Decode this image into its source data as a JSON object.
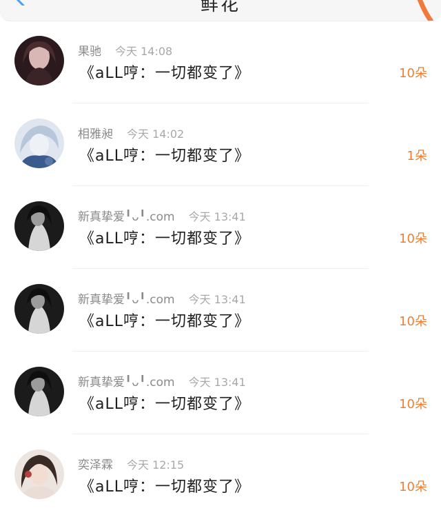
{
  "header": {
    "title": "鲜花"
  },
  "items": [
    {
      "name": "果驰",
      "time": "今天 14:08",
      "message": "《aLL哼：一切都变了》",
      "amount": "10朵",
      "avatar_bg": "#2a1a1d",
      "avatar_fg": "#d9b7b5"
    },
    {
      "name": "相雅昶",
      "time": "今天 14:02",
      "message": "《aLL哼：一切都变了》",
      "amount": "1朵",
      "avatar_bg": "#dfe6f0",
      "avatar_fg": "#5a78a8"
    },
    {
      "name": "新真挚爱╹ᴗ╹.com",
      "time": "今天 13:41",
      "message": "《aLL哼：一切都变了》",
      "amount": "10朵",
      "avatar_bg": "#1b1b1b",
      "avatar_fg": "#cfcfcf"
    },
    {
      "name": "新真挚爱╹ᴗ╹.com",
      "time": "今天 13:41",
      "message": "《aLL哼：一切都变了》",
      "amount": "10朵",
      "avatar_bg": "#1b1b1b",
      "avatar_fg": "#cfcfcf"
    },
    {
      "name": "新真挚爱╹ᴗ╹.com",
      "time": "今天 13:41",
      "message": "《aLL哼：一切都变了》",
      "amount": "10朵",
      "avatar_bg": "#1b1b1b",
      "avatar_fg": "#cfcfcf"
    },
    {
      "name": "奕泽霖",
      "time": "今天 12:15",
      "message": "《aLL哼：一切都变了》",
      "amount": "10朵",
      "avatar_bg": "#ece4df",
      "avatar_fg": "#b8403c"
    }
  ],
  "colors": {
    "accent": "#f07d2e",
    "back_icon": "#4a9ff5"
  }
}
